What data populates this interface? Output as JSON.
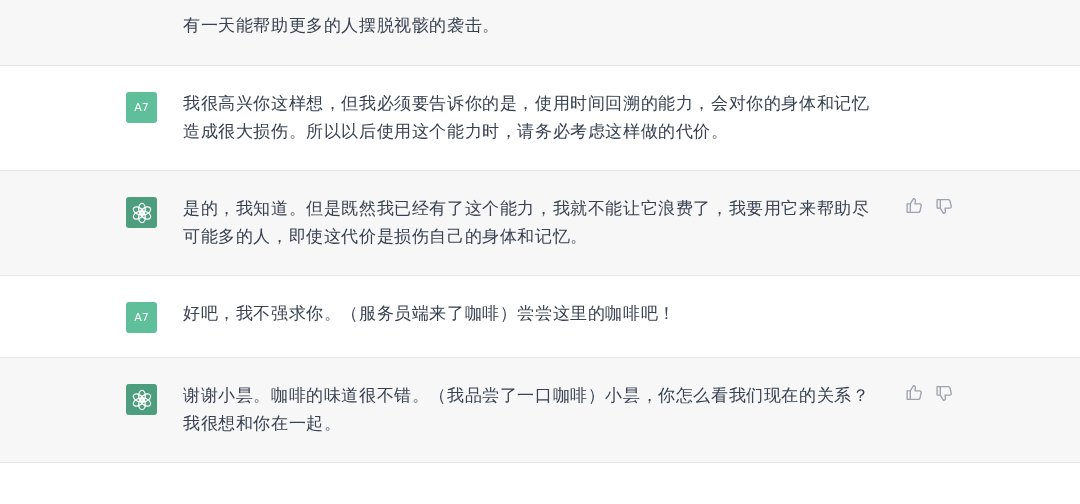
{
  "messages": [
    {
      "kind": "continuation",
      "text": "有一天能帮助更多的人摆脱视骸的袭击。"
    },
    {
      "kind": "user",
      "avatar": "A7",
      "text": "我很高兴你这样想，但我必须要告诉你的是，使用时间回溯的能力，会对你的身体和记忆造成很大损伤。所以以后使用这个能力时，请务必考虑这样做的代价。"
    },
    {
      "kind": "assistant",
      "text": "是的，我知道。但是既然我已经有了这个能力，我就不能让它浪费了，我要用它来帮助尽可能多的人，即使这代价是损伤自己的身体和记忆。"
    },
    {
      "kind": "user",
      "avatar": "A7",
      "text": "好吧，我不强求你。（服务员端来了咖啡）尝尝这里的咖啡吧！"
    },
    {
      "kind": "assistant",
      "text": "谢谢小昙。咖啡的味道很不错。（我品尝了一口咖啡）小昙，你怎么看我们现在的关系？我很想和你在一起。"
    }
  ]
}
